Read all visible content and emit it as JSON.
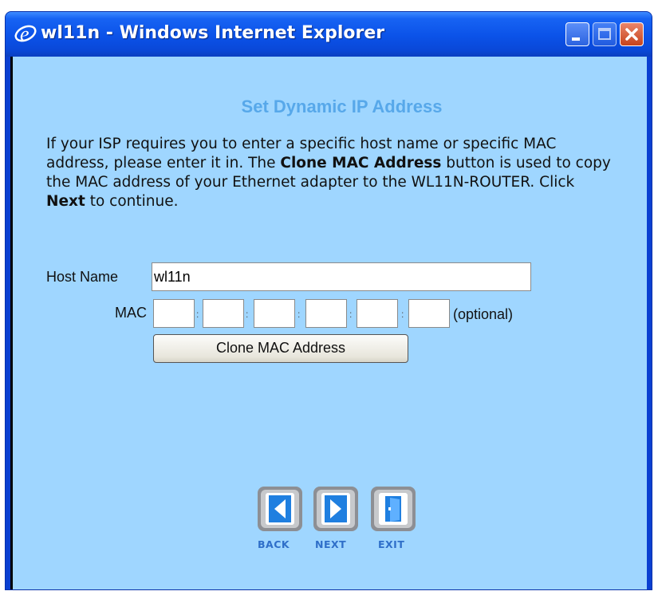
{
  "window": {
    "title": "wl11n - Windows Internet Explorer",
    "controls": [
      "minimize-icon",
      "maximize-icon",
      "close-icon"
    ]
  },
  "page": {
    "heading": "Set Dynamic IP Address",
    "intro_1": "If your ISP requires you to enter a specific host name or specific MAC address, please enter it in. The ",
    "intro_bold_1": "Clone MAC Address",
    "intro_2": " button is used to copy the MAC address of your Ethernet adapter to the WL11N-ROUTER. Click ",
    "intro_bold_2": "Next",
    "intro_3": " to continue."
  },
  "form": {
    "host_name_label": "Host Name",
    "host_name_value": "wl11n",
    "mac_label": "MAC",
    "mac_values": [
      "",
      "",
      "",
      "",
      "",
      ""
    ],
    "mac_separator": ":",
    "mac_optional": "(optional)",
    "clone_button": "Clone MAC Address"
  },
  "nav": {
    "back_label": "BACK",
    "next_label": "NEXT",
    "exit_label": "EXIT"
  },
  "colors": {
    "titlebar": "#0b52e8",
    "content_bg": "#9fd6ff",
    "heading": "#57a8ea",
    "nav_label": "#2f6fc9",
    "nav_icon": "#1f7fe0"
  }
}
